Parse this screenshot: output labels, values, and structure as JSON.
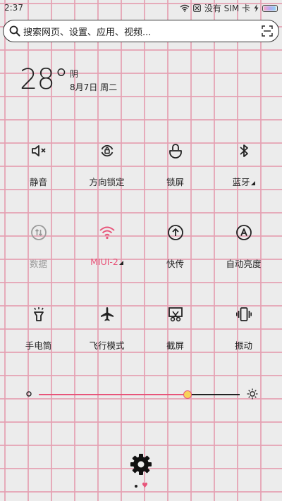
{
  "status_bar": {
    "time": "2:37",
    "carrier_text": "没有 SIM 卡",
    "battery_level": 0.95
  },
  "search": {
    "placeholder": "搜索网页、设置、应用、视频..."
  },
  "weather": {
    "temperature": "28°",
    "condition": "阴",
    "date": "8月7日 周二"
  },
  "toggles": [
    {
      "label": "静音",
      "icon": "mute-icon",
      "state": "off"
    },
    {
      "label": "方向锁定",
      "icon": "rotation-lock-icon",
      "state": "off"
    },
    {
      "label": "锁屏",
      "icon": "lock-icon",
      "state": "off"
    },
    {
      "label": "蓝牙",
      "icon": "bluetooth-icon",
      "state": "off",
      "has_menu": true
    },
    {
      "label": "数据",
      "icon": "mobile-data-icon",
      "state": "disabled"
    },
    {
      "label": "MIUI-2",
      "icon": "wifi-icon",
      "state": "on",
      "has_menu": true
    },
    {
      "label": "快传",
      "icon": "quick-transfer-icon",
      "state": "off"
    },
    {
      "label": "自动亮度",
      "icon": "auto-brightness-icon",
      "state": "off"
    },
    {
      "label": "手电筒",
      "icon": "flashlight-icon",
      "state": "off"
    },
    {
      "label": "飞行模式",
      "icon": "airplane-mode-icon",
      "state": "off"
    },
    {
      "label": "截屏",
      "icon": "screenshot-icon",
      "state": "off"
    },
    {
      "label": "振动",
      "icon": "vibrate-icon",
      "state": "off"
    }
  ],
  "brightness": {
    "level": 0.74
  },
  "colors": {
    "accent": "#e8557a",
    "text": "#222222",
    "disabled": "#999999",
    "grid_line": "#e5a0b2"
  }
}
